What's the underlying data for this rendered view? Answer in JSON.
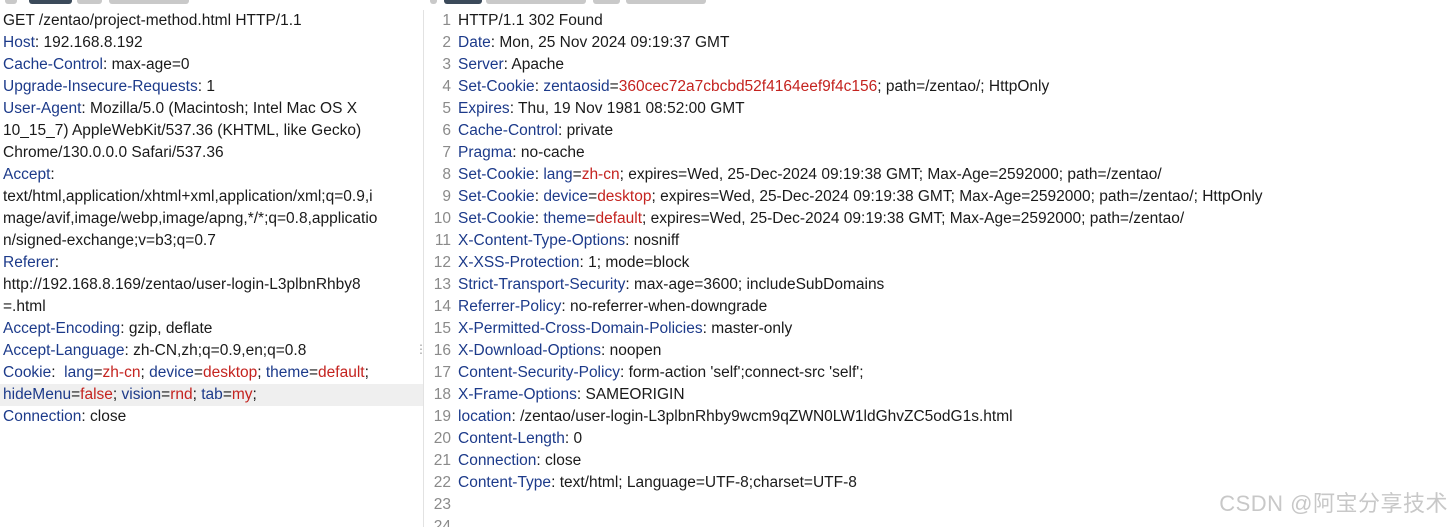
{
  "request": {
    "request_line": "GET /zentao/project-method.html HTTP/1.1",
    "host": {
      "name": "Host",
      "sep": ": ",
      "value": "192.168.8.192"
    },
    "cache_control": {
      "name": "Cache-Control",
      "sep": ": ",
      "value": "max-age=0"
    },
    "upgrade": {
      "name": "Upgrade-Insecure-Requests",
      "sep": ": ",
      "value": "1"
    },
    "user_agent": {
      "name": "User-Agent",
      "sep": ": ",
      "value_1": "Mozilla/5.0 (Macintosh; Intel Mac OS X",
      "value_2": "10_15_7) AppleWebKit/537.36 (KHTML, like Gecko)",
      "value_3": "Chrome/130.0.0.0 Safari/537.36"
    },
    "accept": {
      "name": "Accept",
      "sep": ":",
      "value_1": "text/html,application/xhtml+xml,application/xml;q=0.9,i",
      "value_2": "mage/avif,image/webp,image/apng,*/*;q=0.8,applicatio",
      "value_3": "n/signed-exchange;v=b3;q=0.7"
    },
    "referer": {
      "name": "Referer",
      "sep": ":",
      "value_1": "http://192.168.8.169/zentao/user-login-L3plbnRhby8",
      "value_2": "=.html"
    },
    "accept_encoding": {
      "name": "Accept-Encoding",
      "sep": ": ",
      "value": "gzip, deflate"
    },
    "accept_language": {
      "name": "Accept-Language",
      "sep": ": ",
      "value": "zh-CN,zh;q=0.9,en;q=0.8"
    },
    "cookie": {
      "name": "Cookie",
      "sep": ":  ",
      "k1": "lang",
      "v1": "zh-cn",
      "k2": "device",
      "v2": "desktop",
      "k3": "theme",
      "v3": "default",
      "k4": "hideMenu",
      "v4": "false",
      "k5": "vision",
      "v5": "rnd",
      "k6": "tab",
      "v6": "my",
      "eq": "=",
      "semi": "; ",
      "end": ";"
    },
    "connection": {
      "name": "Connection",
      "sep": ": ",
      "value": "close"
    }
  },
  "response": {
    "line_numbers": [
      "1",
      "2",
      "3",
      "4",
      "5",
      "6",
      "7",
      "8",
      "9",
      "10",
      "11",
      "12",
      "13",
      "14",
      "15",
      "16",
      "17",
      "18",
      "19",
      "20",
      "21",
      "22",
      "23",
      "24"
    ],
    "status_line": "HTTP/1.1 302 Found",
    "date": {
      "name": "Date",
      "sep": ": ",
      "value": "Mon, 25 Nov 2024 09:19:37 GMT"
    },
    "server": {
      "name": "Server",
      "sep": ": ",
      "value": "Apache"
    },
    "set_cookie_sid": {
      "name": "Set-Cookie",
      "sep": ": ",
      "key": "zentaosid",
      "eq": "=",
      "val": "360cec72a7cbcbd52f4164eef9f4c156",
      "rest": "; path=/zentao/; HttpOnly"
    },
    "expires": {
      "name": "Expires",
      "sep": ": ",
      "value": "Thu, 19 Nov 1981 08:52:00 GMT"
    },
    "cache_control": {
      "name": "Cache-Control",
      "sep": ": ",
      "value": "private"
    },
    "pragma": {
      "name": "Pragma",
      "sep": ": ",
      "value": "no-cache"
    },
    "set_cookie_lang": {
      "name": "Set-Cookie",
      "sep": ": ",
      "key": "lang",
      "eq": "=",
      "val": "zh-cn",
      "rest": "; expires=Wed, 25-Dec-2024 09:19:38 GMT; Max-Age=2592000; path=/zentao/"
    },
    "set_cookie_device": {
      "name": "Set-Cookie",
      "sep": ": ",
      "key": "device",
      "eq": "=",
      "val": "desktop",
      "rest": "; expires=Wed, 25-Dec-2024 09:19:38 GMT; Max-Age=2592000; path=/zentao/; HttpOnly"
    },
    "set_cookie_theme": {
      "name": "Set-Cookie",
      "sep": ": ",
      "key": "theme",
      "eq": "=",
      "val": "default",
      "rest": "; expires=Wed, 25-Dec-2024 09:19:38 GMT; Max-Age=2592000; path=/zentao/"
    },
    "x_content_type": {
      "name": "X-Content-Type-Options",
      "sep": ": ",
      "value": "nosniff"
    },
    "x_xss": {
      "name": "X-XSS-Protection",
      "sep": ": ",
      "value": "1; mode=block"
    },
    "hsts": {
      "name": "Strict-Transport-Security",
      "sep": ": ",
      "value": "max-age=3600; includeSubDomains"
    },
    "referrer_policy": {
      "name": "Referrer-Policy",
      "sep": ": ",
      "value": "no-referrer-when-downgrade"
    },
    "x_cross_domain": {
      "name": "X-Permitted-Cross-Domain-Policies",
      "sep": ": ",
      "value": "master-only"
    },
    "x_download": {
      "name": "X-Download-Options",
      "sep": ": ",
      "value": "noopen"
    },
    "csp": {
      "name": "Content-Security-Policy",
      "sep": ": ",
      "value": "form-action 'self';connect-src 'self';"
    },
    "x_frame": {
      "name": "X-Frame-Options",
      "sep": ": ",
      "value": "SAMEORIGIN"
    },
    "location": {
      "name": "location",
      "sep": ": ",
      "value": "/zentao/user-login-L3plbnRhby9wcm9qZWN0LW1ldGhvZC5odG1s.html"
    },
    "content_length": {
      "name": "Content-Length",
      "sep": ": ",
      "value": "0"
    },
    "connection": {
      "name": "Connection",
      "sep": ": ",
      "value": "close"
    },
    "content_type": {
      "name": "Content-Type",
      "sep": ": ",
      "value": "text/html; Language=UTF-8;charset=UTF-8"
    }
  },
  "fold_glyph": "⋮",
  "watermark": "CSDN @阿宝分享技术",
  "colors": {
    "header_name": "#1c3a8a",
    "cookie_value": "#c4231f",
    "line_number": "#8a8a8a",
    "highlight_row": "#efefef"
  }
}
